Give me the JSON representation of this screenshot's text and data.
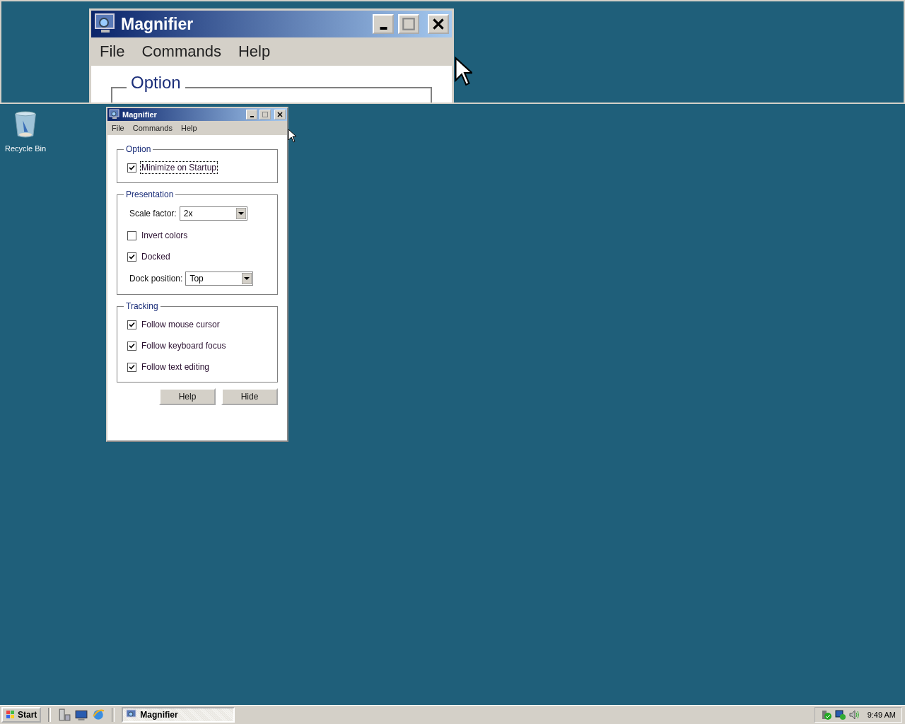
{
  "magnified_view": {
    "title": "Magnifier",
    "menu": [
      "File",
      "Commands",
      "Help"
    ],
    "group_label": "Option"
  },
  "desktop_icons": [
    {
      "label": "Recycle Bin"
    }
  ],
  "window": {
    "title": "Magnifier",
    "menu": [
      "File",
      "Commands",
      "Help"
    ],
    "groups": [
      {
        "label": "Option",
        "items": [
          {
            "kind": "checkbox",
            "label": "Minimize on Startup",
            "checked": true,
            "focused": true
          }
        ]
      },
      {
        "label": "Presentation",
        "items": [
          {
            "kind": "dropdown",
            "label": "Scale factor:",
            "value": "2x"
          },
          {
            "kind": "checkbox",
            "label": "Invert colors",
            "checked": false,
            "focused": false
          },
          {
            "kind": "checkbox",
            "label": "Docked",
            "checked": true,
            "focused": false
          },
          {
            "kind": "dropdown",
            "label": "Dock position:",
            "value": "Top"
          }
        ]
      },
      {
        "label": "Tracking",
        "items": [
          {
            "kind": "checkbox",
            "label": "Follow mouse cursor",
            "checked": true,
            "focused": false
          },
          {
            "kind": "checkbox",
            "label": "Follow keyboard focus",
            "checked": true,
            "focused": false
          },
          {
            "kind": "checkbox",
            "label": "Follow text editing",
            "checked": true,
            "focused": false
          }
        ]
      }
    ],
    "buttons": [
      "Help",
      "Hide"
    ]
  },
  "taskbar": {
    "start": "Start",
    "tasks": [
      {
        "label": "Magnifier",
        "selected": true
      }
    ],
    "clock": "9:49 AM"
  }
}
